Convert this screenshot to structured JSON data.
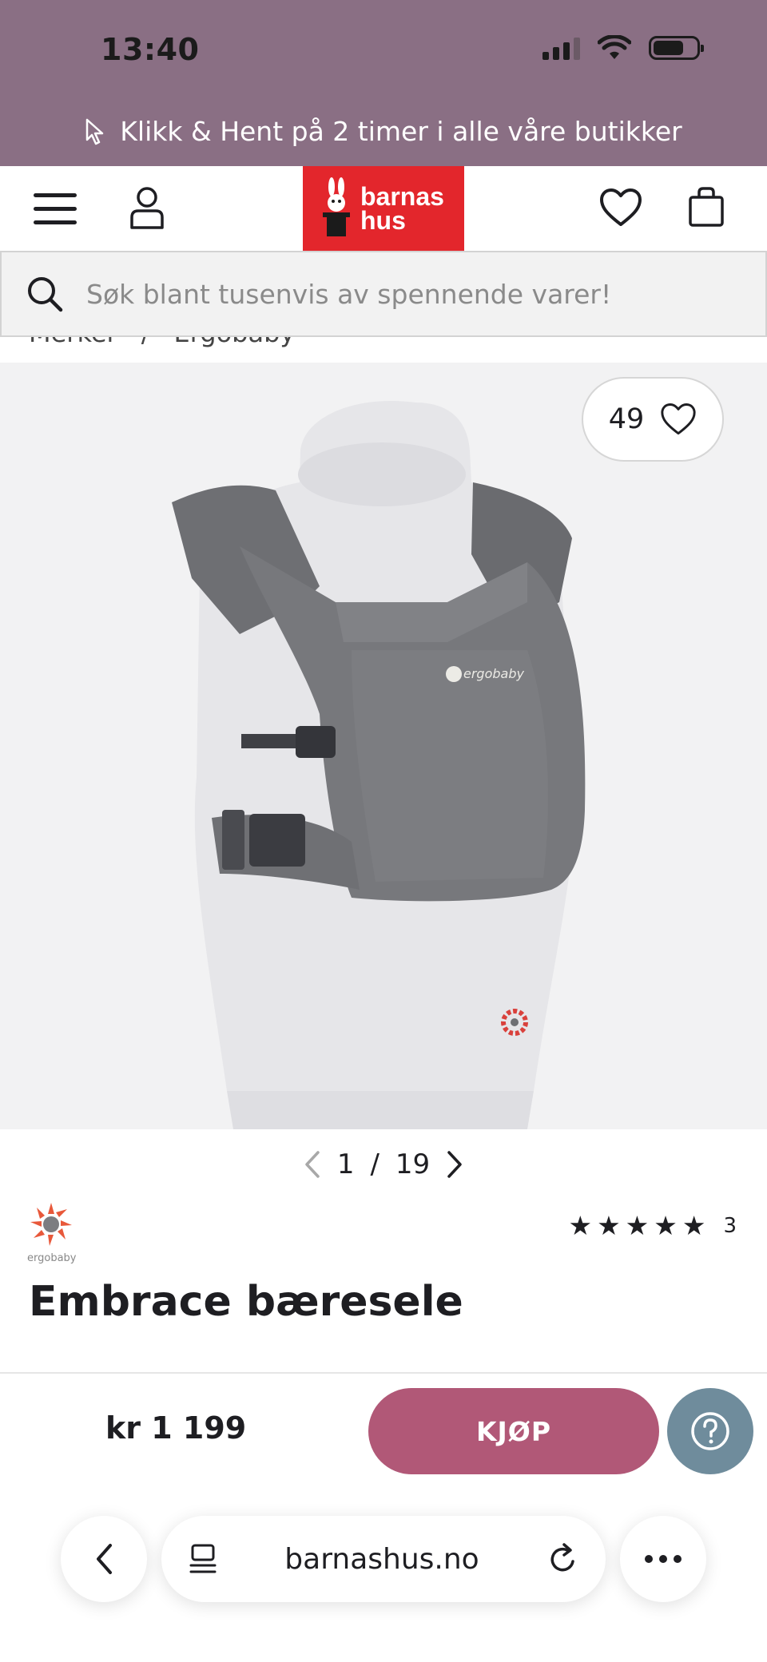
{
  "status_bar": {
    "time": "13:40"
  },
  "promo": {
    "text": "Klikk & Hent på 2 timer i alle våre butikker"
  },
  "header": {
    "logo_line1": "barnas",
    "logo_line2": "hus"
  },
  "search": {
    "placeholder": "Søk blant tusenvis av spennende varer!"
  },
  "breadcrumb": {
    "items": [
      "Merker",
      "/",
      "Ergobaby"
    ]
  },
  "gallery": {
    "favorites_count": "49",
    "current": "1",
    "separator": "/",
    "total": "19"
  },
  "product": {
    "brand": "ergobaby",
    "garment_logo_text": "ergobaby",
    "title": "Embrace bæresele",
    "rating_value": 5,
    "rating_count": "3",
    "price": "kr 1 199",
    "buy_label": "KJØP"
  },
  "browser": {
    "url": "barnashus.no"
  },
  "colors": {
    "promo_bg": "#8a6f84",
    "logo_red": "#e3262c",
    "buy_button": "#b15877",
    "help_button": "#6f8c9c"
  }
}
